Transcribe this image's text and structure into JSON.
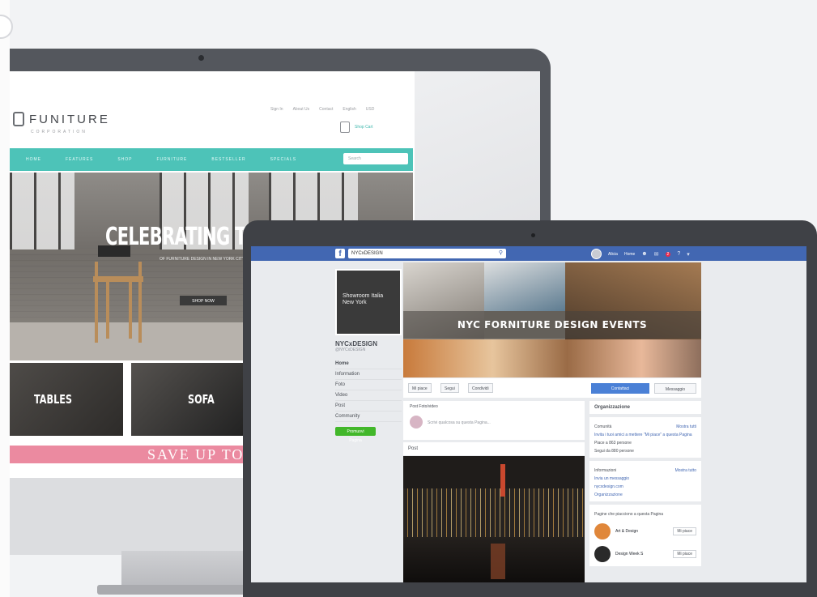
{
  "furniture_site": {
    "logo_text": "FUNITURE",
    "logo_sub": "CORPORATION",
    "top_links": [
      "Sign In",
      "About Us",
      "Contact",
      "English",
      "USD"
    ],
    "cart_label": "Shop Cart",
    "nav_items": [
      "HOME",
      "FEATURES",
      "SHOP",
      "FURNITURE",
      "BESTSELLER",
      "SPECIALS"
    ],
    "search_placeholder": "Search",
    "hero_title": "CELEBRATING THE",
    "hero_sub": "OF FURNITURE DESIGN IN NEW YORK CITY",
    "hero_button": "SHOP NOW",
    "tile1_caption": "TABLES",
    "tile2_caption": "SOFA",
    "promo_text": "SAVE UP TO"
  },
  "facebook": {
    "search_value": "NYCxDESIGN",
    "top_user": "Alicia",
    "top_home": "Home",
    "notif_count": "2",
    "page_pic_text": "Showroom Italia New York",
    "page_name": "NYCxDESIGN",
    "page_handle": "@NYCxDESIGN",
    "left_nav": [
      "Home",
      "Information",
      "Foto",
      "Video",
      "Post",
      "Community"
    ],
    "promote_label": "Promuovi Pagina",
    "cover_title": "NYC FORNITURE DESIGN EVENTS",
    "action_buttons": [
      "Mi piace",
      "Segui",
      "Condividi"
    ],
    "contact_label": "Contattaci",
    "message_label": "Messaggio",
    "composer_tabs": "Post   Foto/video",
    "composer_placeholder": "Scrivi qualcosa su questa Pagina...",
    "post_header": "Post",
    "right_boxes": {
      "org": "Organizzazione",
      "community_title": "Comunità",
      "community_link": "Mostra tutti",
      "community_rows": [
        "Invita i tuoi amici a mettere \"Mi piace\" a questa Pagina",
        "Piace a 863 persone",
        "Segui da 880 persone"
      ],
      "info_title": "Informazioni",
      "info_link": "Mostra tutto",
      "info_rows": [
        "Invia un messaggio",
        "nycxdesign.com",
        "Organizzazione"
      ],
      "liked_title": "Pagine che piacciono a questa Pagina",
      "suggestions": [
        {
          "name": "Art & Design",
          "action": "Mi piace"
        },
        {
          "name": "Design Week S",
          "action": "Mi piace"
        }
      ]
    }
  },
  "colors": {
    "teal": "#4dc3b8",
    "facebook_blue": "#4267b2",
    "promo_pink": "#eb8aa0",
    "green": "#42b72a"
  }
}
